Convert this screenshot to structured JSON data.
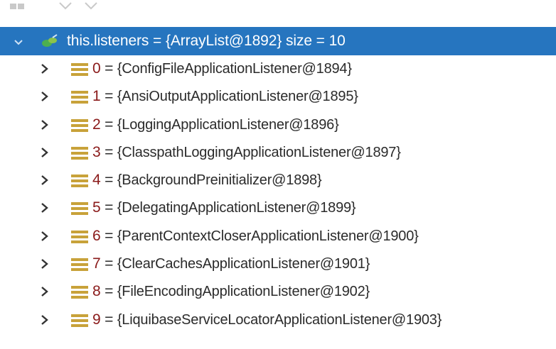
{
  "root": {
    "label": "this.listeners = {ArrayList@1892}  size = 10",
    "expand_icon": "chevron-down-icon",
    "object_icon": "field-watch-icon"
  },
  "items": [
    {
      "index": "0",
      "eq": " = ",
      "value": "{ConfigFileApplicationListener@1894}"
    },
    {
      "index": "1",
      "eq": " = ",
      "value": "{AnsiOutputApplicationListener@1895}"
    },
    {
      "index": "2",
      "eq": " = ",
      "value": "{LoggingApplicationListener@1896}"
    },
    {
      "index": "3",
      "eq": " = ",
      "value": "{ClasspathLoggingApplicationListener@1897}"
    },
    {
      "index": "4",
      "eq": " = ",
      "value": "{BackgroundPreinitializer@1898}"
    },
    {
      "index": "5",
      "eq": " = ",
      "value": "{DelegatingApplicationListener@1899}"
    },
    {
      "index": "6",
      "eq": " = ",
      "value": "{ParentContextCloserApplicationListener@1900}"
    },
    {
      "index": "7",
      "eq": " = ",
      "value": "{ClearCachesApplicationListener@1901}"
    },
    {
      "index": "8",
      "eq": " = ",
      "value": "{FileEncodingApplicationListener@1902}"
    },
    {
      "index": "9",
      "eq": " = ",
      "value": "{LiquibaseServiceLocatorApplicationListener@1903}"
    }
  ],
  "colors": {
    "selection": "#2675bf",
    "index_text": "#8a1a1a",
    "value_text": "#2b2b2b",
    "list_icon": "#c8a23a"
  }
}
